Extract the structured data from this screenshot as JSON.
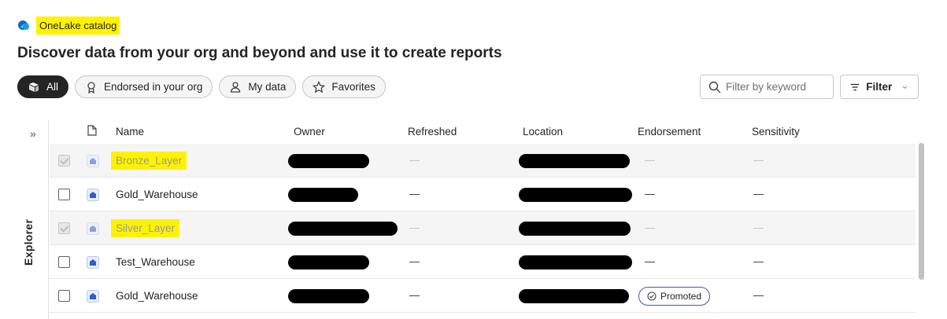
{
  "breadcrumb": {
    "title": "OneLake catalog",
    "logo_icon": "onelake-icon"
  },
  "page_title": "Discover data from your org and beyond and use it to create reports",
  "pills": [
    {
      "label": "All",
      "icon": "catalog-icon",
      "active": true
    },
    {
      "label": "Endorsed in your org",
      "icon": "ribbon-icon",
      "active": false
    },
    {
      "label": "My data",
      "icon": "person-icon",
      "active": false
    },
    {
      "label": "Favorites",
      "icon": "star-icon",
      "active": false
    }
  ],
  "search": {
    "placeholder": "Filter by keyword",
    "icon": "search-icon"
  },
  "filter_button": {
    "label": "Filter",
    "icon": "filter-icon"
  },
  "explorer": {
    "label": "Explorer",
    "expand_icon": "chevron-double-right-icon"
  },
  "table": {
    "headers": {
      "type_icon": "file-icon",
      "name": "Name",
      "owner": "Owner",
      "refreshed": "Refreshed",
      "location": "Location",
      "endorsement": "Endorsement",
      "sensitivity": "Sensitivity"
    },
    "rows": [
      {
        "name": "Bronze_Layer",
        "highlighted": true,
        "disabled": true,
        "endorsement": ""
      },
      {
        "name": "Gold_Warehouse",
        "highlighted": false,
        "disabled": false,
        "endorsement": ""
      },
      {
        "name": "Silver_Layer",
        "highlighted": true,
        "disabled": true,
        "endorsement": ""
      },
      {
        "name": "Test_Warehouse",
        "highlighted": false,
        "disabled": false,
        "endorsement": ""
      },
      {
        "name": "Gold_Warehouse",
        "highlighted": false,
        "disabled": false,
        "endorsement": "Promoted"
      }
    ]
  },
  "colors": {
    "highlight": "#fff200",
    "active_pill": "#242424",
    "badge_border": "#3b5ba5",
    "icon_blue": "#2f5bd3"
  }
}
